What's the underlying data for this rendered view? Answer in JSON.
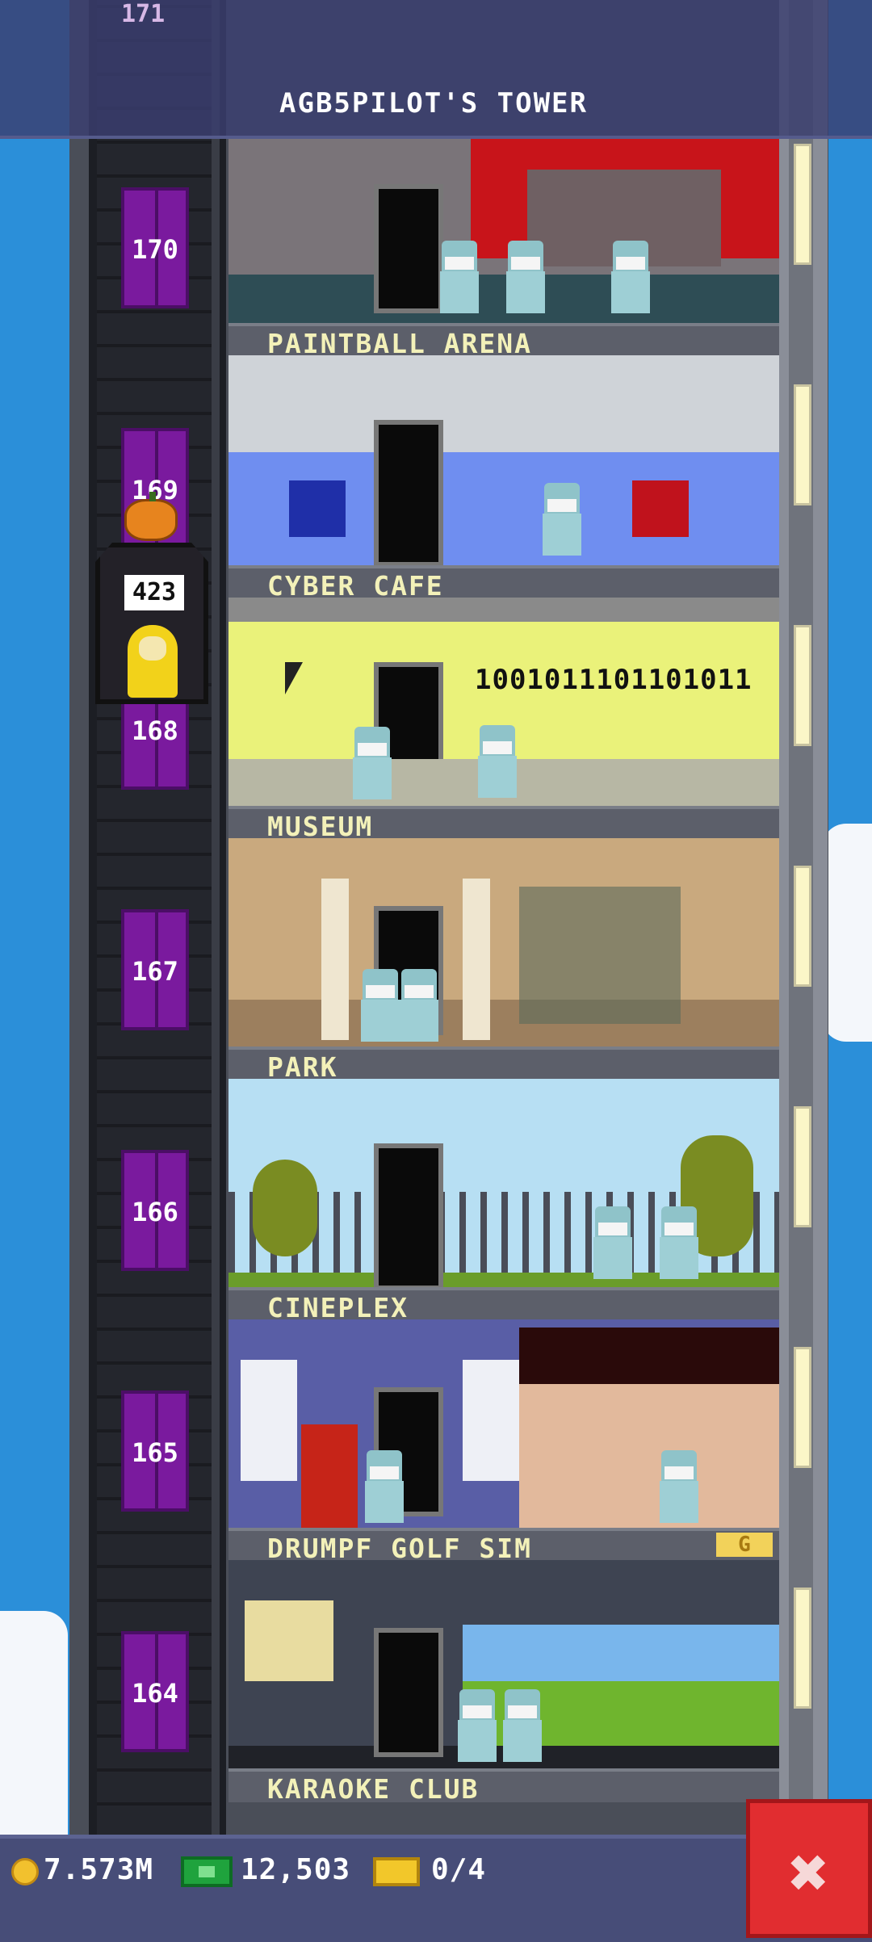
{
  "header": {
    "tower_title": "AGB5PILOT'S TOWER",
    "top_floor_number": "171"
  },
  "elevator": {
    "car_count": "423",
    "floor_numbers": [
      "170",
      "169",
      "168",
      "167",
      "166",
      "165",
      "164"
    ]
  },
  "floors": [
    {
      "name": "PAINTBALL ARENA"
    },
    {
      "name": "CYBER CAFE",
      "display_text": "1001011101101011"
    },
    {
      "name": "MUSEUM"
    },
    {
      "name": "PARK"
    },
    {
      "name": "CINEPLEX"
    },
    {
      "name": "DRUMPF GOLF SIM"
    },
    {
      "name": "KARAOKE CLUB"
    }
  ],
  "floor_badge": "G",
  "bottom_bar": {
    "coins": "7.573M",
    "bux": "12,503",
    "tickets": "0/4"
  },
  "colors": {
    "sky": "#2b8fd9",
    "elevator_door": "#7a1a9e",
    "floor_label_text": "#f3f1b9",
    "close_button": "#e12d30"
  }
}
